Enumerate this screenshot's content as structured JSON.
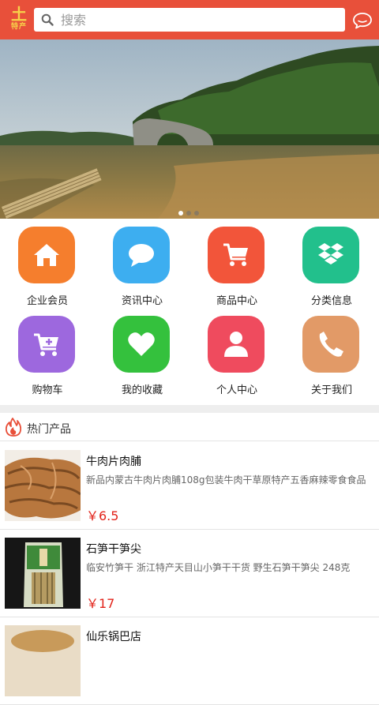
{
  "header": {
    "logo_big": "土",
    "logo_small": "特产",
    "search_placeholder": "搜索"
  },
  "banner": {
    "slides": 3,
    "active_slide": 1
  },
  "nav": [
    {
      "label": "企业会员",
      "icon": "home-icon",
      "color": "#f57e2d"
    },
    {
      "label": "资讯中心",
      "icon": "chat-bubble-icon",
      "color": "#3daef0"
    },
    {
      "label": "商品中心",
      "icon": "shopping-cart-icon",
      "color": "#f2553a"
    },
    {
      "label": "分类信息",
      "icon": "dropbox-icon",
      "color": "#22c08c"
    },
    {
      "label": "购物车",
      "icon": "cart-add-icon",
      "color": "#9d68de"
    },
    {
      "label": "我的收藏",
      "icon": "heart-icon",
      "color": "#34c13d"
    },
    {
      "label": "个人中心",
      "icon": "user-icon",
      "color": "#ef4b5e"
    },
    {
      "label": "关于我们",
      "icon": "phone-icon",
      "color": "#e29a67"
    }
  ],
  "hot": {
    "title": "热门产品",
    "products": [
      {
        "name": "牛肉片肉脯",
        "desc": "新品内蒙古牛肉片肉脯108g包装牛肉干草原特产五香麻辣零食食品",
        "price": "￥6.5"
      },
      {
        "name": "石笋干笋尖",
        "desc": "临安竹笋干 浙江特产天目山小笋干干货 野生石笋干笋尖 248克",
        "price": "￥17"
      },
      {
        "name": "仙乐锅巴店",
        "desc": "",
        "price": ""
      }
    ]
  }
}
